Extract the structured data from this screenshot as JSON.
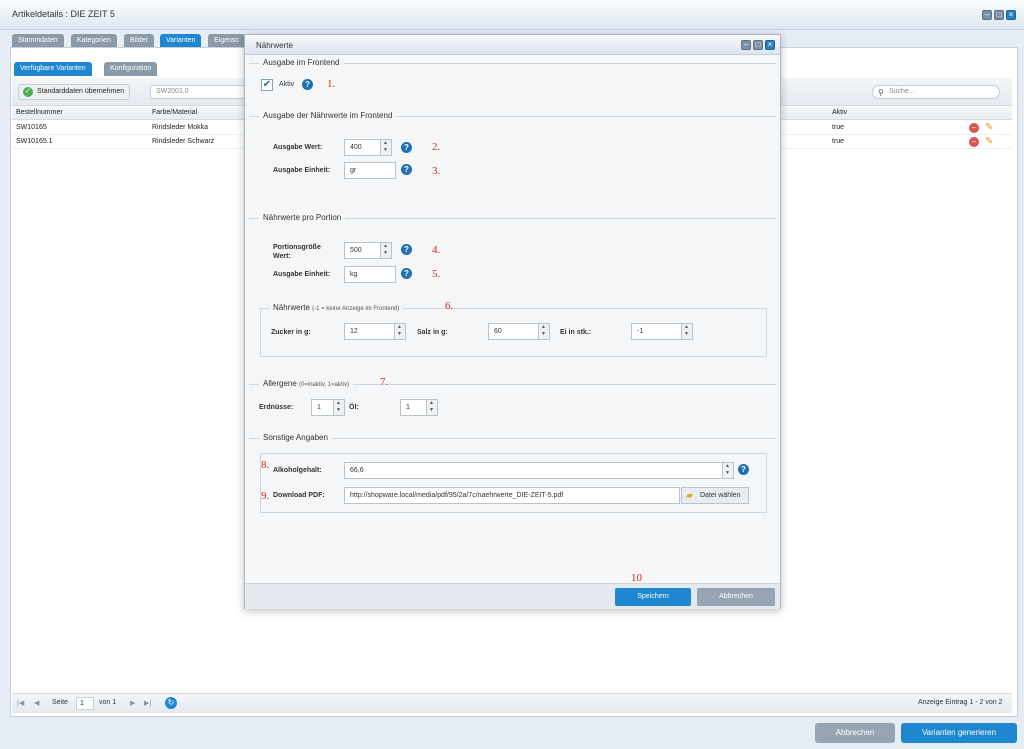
{
  "window": {
    "title": "Artikeldetails : DIE ZEIT 5",
    "tabs": [
      "Stammdaten",
      "Kategorien",
      "Bilder",
      "Varianten",
      "Eigensc"
    ],
    "active_tab": "Varianten"
  },
  "variants": {
    "subtabs": [
      "Verfügbare Varianten",
      "Konfiguration"
    ],
    "toolbar": {
      "standard_button": "Standarddaten übernehmen",
      "sw_placeholder": "SW2001.0",
      "search_placeholder": "Suche..."
    },
    "columns": [
      "Bestellnummer",
      "Farbe/Material",
      "Aktiv"
    ],
    "rows": [
      {
        "number": "SW10165",
        "material": "Rindsleder Mokka",
        "active": "true"
      },
      {
        "number": "SW10165.1",
        "material": "Rindsleder Schwarz",
        "active": "true"
      }
    ],
    "pager": {
      "page_label": "Seite",
      "page_value": "1",
      "of_label": "von 1",
      "display": "Anzeige Eintrag 1 - 2 von 2"
    }
  },
  "footer": {
    "cancel": "Abbrechen",
    "generate": "Varianten generieren"
  },
  "modal": {
    "title": "Nährwerte",
    "s1": {
      "legend": "Ausgabe im Frontend",
      "aktiv_label": "Aktiv",
      "checked": true,
      "marker": "1."
    },
    "s2": {
      "legend": "Ausgabe der Nährwerte im Frontend",
      "wert_label": "Ausgabe Wert:",
      "wert_value": "400",
      "einheit_label": "Ausgabe Einheit:",
      "einheit_value": "gr",
      "marker_wert": "2.",
      "marker_einheit": "3."
    },
    "s3": {
      "legend": "Nährwerte pro Portion",
      "portion_label_1": "Portionsgröße",
      "portion_label_2": "Wert:",
      "portion_value": "500",
      "einheit_label": "Ausgabe Einheit:",
      "einheit_value": "kg",
      "marker_portion": "4.",
      "marker_einheit": "5.",
      "nutri_legend": "Nährwerte",
      "nutri_note": "(-1 = keine Anzeige im Frontend)",
      "marker_nutri": "6.",
      "zucker_label": "Zucker in g:",
      "zucker_value": "12",
      "salz_label": "Salz in g:",
      "salz_value": "60",
      "ei_label": "Ei in stk.:",
      "ei_value": "-1"
    },
    "s4": {
      "legend": "Allergene",
      "note": "(0=inaktiv, 1=aktiv)",
      "marker": "7.",
      "erdnuesse_label": "Erdnüsse:",
      "erdnuesse_value": "1",
      "oel_label": "Öl:",
      "oel_value": "1"
    },
    "s5": {
      "legend": "Sonstige Angaben",
      "alkohol_label": "Alkoholgehalt:",
      "alkohol_value": "66,6",
      "marker_alkohol": "8.",
      "pdf_label": "Download PDF:",
      "pdf_value": "http://shopware.local/media/pdf/95/2a/7c/naehrwerte_DIE-ZEIT-5.pdf",
      "marker_pdf": "9.",
      "file_button": "Datei wählen"
    },
    "marker_save": "10",
    "save": "Speichern",
    "cancel": "Abbrechen"
  },
  "colors": {
    "primary": "#1f86d0",
    "marker_red": "#d32a1f",
    "delete_red": "#d9534f",
    "edit_orange": "#e89a21",
    "tab_gray": "#8b9aa8"
  },
  "icons": [
    "minimize-icon",
    "maximize-icon",
    "close-icon",
    "check-circle-icon",
    "search-icon",
    "delete-icon",
    "edit-icon",
    "refresh-icon",
    "help-icon",
    "folder-icon"
  ]
}
